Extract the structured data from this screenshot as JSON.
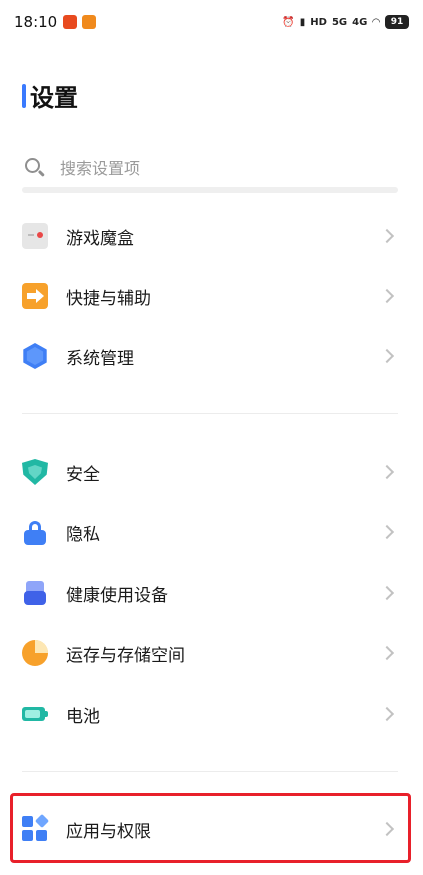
{
  "status_bar": {
    "time": "18:10",
    "signal_1": "5G",
    "signal_2": "4G",
    "battery": "91"
  },
  "page": {
    "title": "设置"
  },
  "search": {
    "placeholder": "搜索设置项"
  },
  "groups": [
    {
      "items": [
        {
          "label": "游戏魔盒",
          "icon": "game-box-icon"
        },
        {
          "label": "快捷与辅助",
          "icon": "shortcut-arrow-icon"
        },
        {
          "label": "系统管理",
          "icon": "system-hexagon-icon"
        }
      ]
    },
    {
      "items": [
        {
          "label": "安全",
          "icon": "shield-icon"
        },
        {
          "label": "隐私",
          "icon": "lock-icon"
        },
        {
          "label": "健康使用设备",
          "icon": "health-device-icon"
        },
        {
          "label": "运存与存储空间",
          "icon": "storage-pie-icon"
        },
        {
          "label": "电池",
          "icon": "battery-icon"
        }
      ]
    },
    {
      "items": [
        {
          "label": "应用与权限",
          "icon": "apps-grid-icon"
        }
      ]
    }
  ],
  "colors": {
    "accent": "#3f7ff5",
    "highlight": "#e8202a",
    "teal": "#21b8a4",
    "orange": "#f7a12b"
  }
}
